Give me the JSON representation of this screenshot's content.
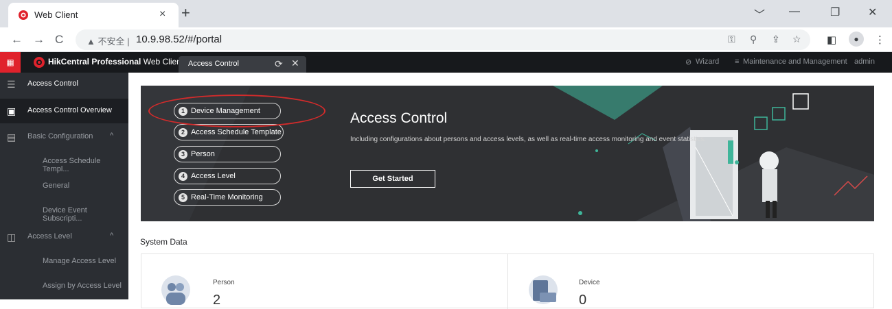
{
  "browser": {
    "tab_title": "Web Client",
    "tab_close": "×",
    "new_tab": "+",
    "window_controls": [
      "﹀",
      "—",
      "❐",
      "✕"
    ],
    "insecure_label": "▲ 不安全 |",
    "url": "10.9.98.52/#/portal"
  },
  "app": {
    "brand_name": "HikCentral Professional",
    "brand_suffix": " Web Client",
    "tab_label": "Access Control",
    "wizard": "Wizard",
    "maintenance": "Maintenance and Management",
    "user": "admin"
  },
  "sidebar": {
    "header": "Access Control",
    "items": [
      {
        "label": "Access Control Overview"
      },
      {
        "label": "Basic Configuration"
      },
      {
        "label": "Access Schedule Templ..."
      },
      {
        "label": "General"
      },
      {
        "label": "Device Event Subscripti..."
      },
      {
        "label": "Access Level"
      },
      {
        "label": "Manage Access Level"
      },
      {
        "label": "Assign by Access Level"
      }
    ]
  },
  "banner": {
    "title": "Access Control",
    "description": "Including configurations about persons and access levels, as well as real-time access monitoring and event statistics.",
    "button": "Get Started",
    "steps": [
      {
        "num": "1",
        "label": "Device Management"
      },
      {
        "num": "2",
        "label": "Access Schedule Template"
      },
      {
        "num": "3",
        "label": "Person"
      },
      {
        "num": "4",
        "label": "Access Level"
      },
      {
        "num": "5",
        "label": "Real-Time Monitoring"
      }
    ]
  },
  "system_data": {
    "title": "System Data",
    "person_label": "Person",
    "person_value": "2",
    "device_label": "Device",
    "device_value": "0"
  },
  "colors": {
    "accent": "#e0222c",
    "highlight": "#d42b2b",
    "teal": "#3fb59a"
  }
}
